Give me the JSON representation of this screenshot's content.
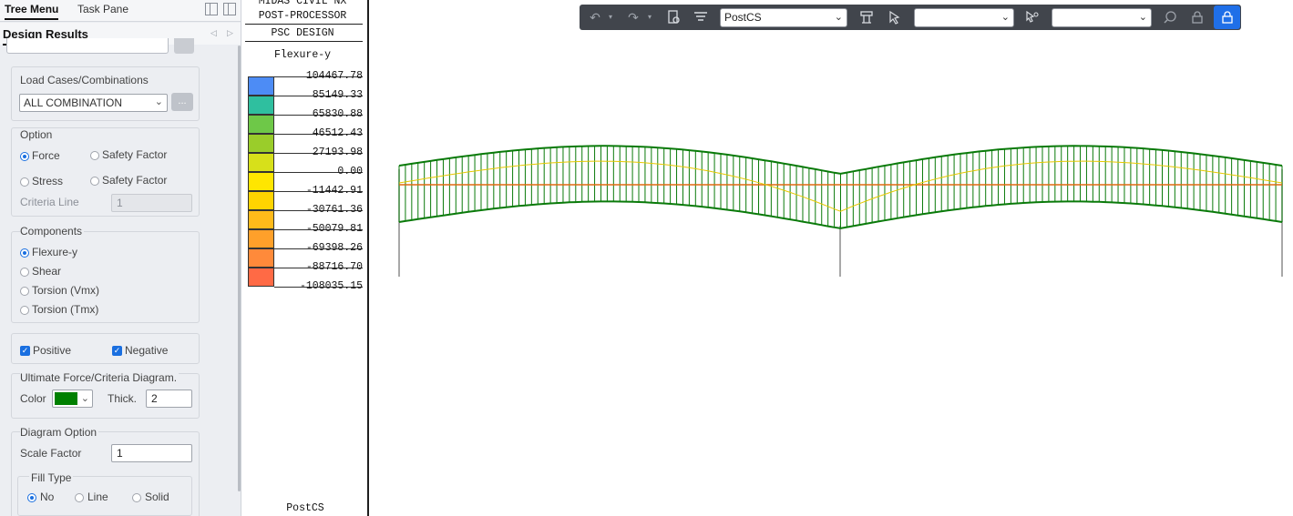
{
  "tabs": {
    "tree_menu": "Tree Menu",
    "task_pane": "Task Pane"
  },
  "panel": {
    "title": "Design Results"
  },
  "load_cases": {
    "label": "Load Cases/Combinations",
    "selected": "ALL COMBINATION",
    "browse": "..."
  },
  "option": {
    "label": "Option",
    "force": "Force",
    "force_safety": "Safety Factor",
    "stress": "Stress",
    "stress_safety": "Safety Factor",
    "criteria_label": "Criteria Line",
    "criteria_value": "1",
    "selected": "Force"
  },
  "components": {
    "label": "Components",
    "items": [
      "Flexure-y",
      "Shear",
      "Torsion (Vmx)",
      "Torsion (Tmx)"
    ],
    "selected": "Flexure-y"
  },
  "filters": {
    "positive": "Positive",
    "negative": "Negative",
    "positive_checked": true,
    "negative_checked": true
  },
  "ultimate": {
    "label": "Ultimate Force/Criteria Diagram.",
    "color_label": "Color",
    "color": "#008000",
    "thick_label": "Thick.",
    "thick_value": "2"
  },
  "diagram": {
    "label": "Diagram Option",
    "scale_label": "Scale Factor",
    "scale_value": "1",
    "fill_label": "Fill Type",
    "fill_options": [
      "No",
      "Line",
      "Solid"
    ],
    "fill_selected": "No"
  },
  "legend": {
    "header1": "MIDAS CIVIL NX",
    "header2": "POST-PROCESSOR",
    "header3": "PSC DESIGN",
    "component": "Flexure-y",
    "stage": "PostCS",
    "values": [
      "104467.78",
      "85149.33",
      "65830.88",
      "46512.43",
      "27193.98",
      "0.00",
      "-11442.91",
      "-30761.36",
      "-50079.81",
      "-69398.26",
      "-88716.70",
      "-108035.15"
    ],
    "colors": [
      "#4d8cf5",
      "#2fbf9f",
      "#6ec848",
      "#9acd2a",
      "#d7e01a",
      "#ffe600",
      "#ffd400",
      "#ffba1a",
      "#ffa02a",
      "#ff8a3a",
      "#ff6a45"
    ]
  },
  "toolbar": {
    "stage_select": "PostCS",
    "select2": "",
    "select3": "",
    "icons": [
      "undo-icon",
      "redo-icon",
      "view-icon",
      "filter-icon",
      "structure-icon",
      "pointer-icon",
      "pointer-search-icon",
      "search-icon",
      "lock-icon",
      "lock-active-icon"
    ]
  },
  "diagram_colors": {
    "envelope": "#0a7a0a",
    "axis": "#e06a10",
    "moment": "#e6c800",
    "support": "#8a8a8a"
  }
}
